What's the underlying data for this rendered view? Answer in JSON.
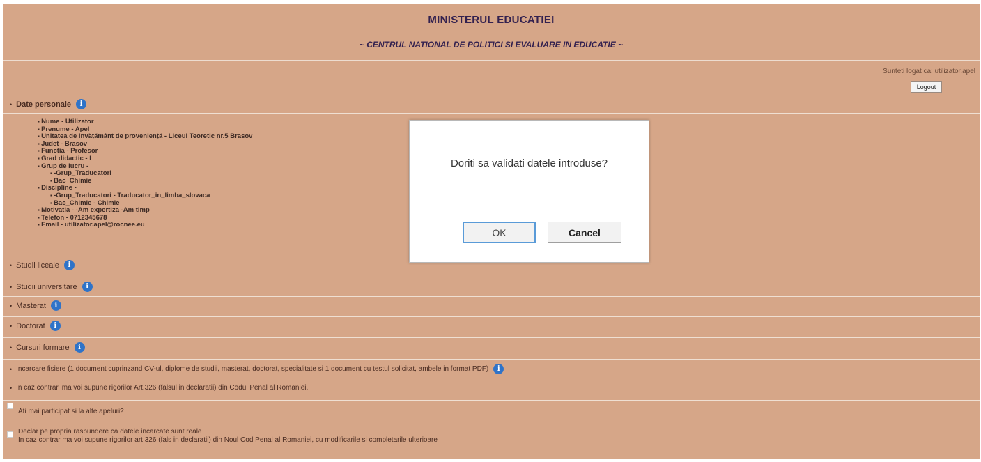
{
  "header": {
    "title": "MINISTERUL EDUCATIEI",
    "subtitle": "~ CENTRUL NATIONAL DE POLITICI SI EVALUARE IN EDUCATIE ~"
  },
  "session": {
    "login_text": "Sunteti logat ca: utilizator.apel",
    "logout_label": "Logout"
  },
  "personal": {
    "label": "Date personale",
    "fields": {
      "nume": "Nume - Utilizator",
      "prenume": "Prenume - Apel",
      "unitate": "Unitatea de învățământ de proveniență - Liceul Teoretic nr.5 Brasov",
      "judet": "Judet - Brasov",
      "functia": "Functia - Profesor",
      "grad": "Grad didactic - I",
      "grup": "Grup de lucru -",
      "grup_items": [
        "-Grup_Traducatori",
        "Bac_Chimie"
      ],
      "discipline": "Discipline -",
      "discipline_items": [
        "-Grup_Traducatori - Traducator_in_limba_slovaca",
        "Bac_Chimie - Chimie"
      ],
      "motivatia": "Motivatia - -Am expertiza -Am timp",
      "telefon": "Telefon - 0712345678",
      "email": "Email - utilizator.apel@rocnee.eu"
    }
  },
  "sections": {
    "liceale": "Studii liceale",
    "universitare": "Studii universitare",
    "masterat": "Masterat",
    "doctorat": "Doctorat",
    "cursuri": "Cursuri formare",
    "incarcare": "Incarcare fisiere (1 document cuprinzand CV-ul, diplome de studii, masterat, doctorat, specialitate si 1 document cu testul solicitat, ambele in format PDF)"
  },
  "notices": {
    "penal": "In caz contrar, ma voi supune rigorilor Art.326 (falsul in declaratii) din Codul Penal al Romaniei.",
    "participat": "Ati mai participat si la alte apeluri?",
    "declar_line1": "Declar pe propria raspundere ca datele incarcate sunt reale",
    "declar_line2": "In caz contrar ma voi supune rigorilor art 326 (fals in declaratii) din Noul Cod Penal al Romaniei, cu modificarile si completarile ulterioare"
  },
  "dialog": {
    "message": "Doriti sa validati datele introduse?",
    "ok_label": "OK",
    "cancel_label": "Cancel"
  },
  "icons": {
    "info": "info-icon",
    "bullet": "bullet-icon"
  },
  "colors": {
    "background": "#d6a688",
    "header_text": "#33214f",
    "info_icon": "#2f73c8",
    "dialog_bg": "#ffffff"
  }
}
